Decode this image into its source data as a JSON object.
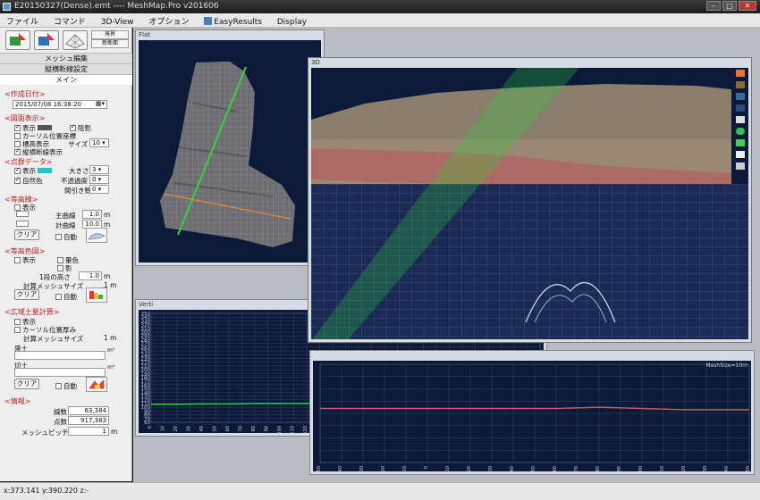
{
  "window": {
    "title": "E20150327(Dense).emt ---- MeshMap.Pro v201606"
  },
  "menu": [
    {
      "label": "ファイル"
    },
    {
      "label": "コマンド"
    },
    {
      "label": "3D-View"
    },
    {
      "label": "オプション"
    },
    {
      "label": "EasyResults"
    },
    {
      "label": "Display"
    }
  ],
  "left": {
    "small_buttons": [
      "境界",
      "新断面"
    ],
    "tabs": [
      "メッシュ編集",
      "縦横断線設定",
      "メイン"
    ],
    "date": {
      "section": "<作成日付>",
      "value": "2015/07/08 16:38:20"
    },
    "display": {
      "section": "<図面表示>",
      "show": "表示",
      "shade": "陰影",
      "cursor_coord": "カーソル位置座標",
      "elevation": "標高表示",
      "size_label": "サイズ",
      "size_value": "10",
      "profile_lines": "縦横断線表示"
    },
    "points": {
      "section": "<点群データ>",
      "show": "表示",
      "natural": "自然色",
      "size_label": "大きさ",
      "size_value": "3",
      "opacity_label": "不透過度",
      "opacity_value": "0",
      "thin_label": "間引き数",
      "thin_value": "0"
    },
    "contour": {
      "section": "<等高線>",
      "show": "表示",
      "main_label": "主曲線",
      "main_value": "1.0",
      "sub_label": "計曲線",
      "sub_value": "10.0",
      "unit": "m",
      "clear": "クリア",
      "auto": "自動"
    },
    "color": {
      "section": "<等高色図>",
      "show": "表示",
      "hatch": "暈色",
      "shadow": "影",
      "step_label": "1段の高さ",
      "step_value": "1.0",
      "unit": "m",
      "mesh_label": "計算メッシュサイズ",
      "mesh_unit": "1 m",
      "clear": "クリア",
      "auto": "自動"
    },
    "volume": {
      "section": "<広域土量計算>",
      "show": "表示",
      "cursor_thick": "カーソル位置厚み",
      "mesh_label": "計算メッシュサイズ",
      "mesh_unit": "1 m",
      "fill_label": "盛土",
      "cut_label": "切土",
      "unit": "m³",
      "clear": "クリア",
      "auto": "自動"
    },
    "info": {
      "section": "<情報>",
      "lines_label": "線数",
      "lines_value": "63,384",
      "points_label": "点数",
      "points_value": "917,383",
      "pitch_label": "メッシュピッチ",
      "pitch_value": "1",
      "unit": "m"
    }
  },
  "panes": {
    "flat": {
      "title": "Flat"
    },
    "view3d": {
      "title": "3D"
    },
    "verti": {
      "title": "Verti"
    },
    "hori": {
      "title": "MeshSize=10m"
    }
  },
  "chart_data": [
    {
      "type": "line",
      "title": "Verti",
      "y_ticks": [
        350,
        340,
        330,
        320,
        310,
        300,
        290,
        280,
        270,
        260,
        250,
        240,
        230,
        220,
        210,
        200,
        190,
        180,
        170,
        160,
        150,
        140,
        130,
        120,
        110,
        100,
        90,
        80,
        70,
        60
      ],
      "x_ticks": [
        0,
        10,
        20,
        30,
        40,
        50,
        60,
        70,
        80,
        90,
        100,
        110,
        120,
        130,
        140,
        150,
        160,
        170,
        180,
        190,
        200,
        210,
        220,
        230,
        240,
        250,
        260,
        270,
        280,
        290,
        300
      ],
      "ylim": [
        60,
        350
      ],
      "series": [
        {
          "color": "#35c435",
          "x": [
            0,
            20,
            40,
            60,
            80,
            100,
            120,
            130,
            140,
            160,
            180,
            200,
            210,
            230,
            250,
            270,
            290,
            300
          ],
          "y": [
            108,
            108,
            109,
            109,
            110,
            110,
            110,
            108,
            102,
            100,
            101,
            103,
            108,
            109,
            109,
            108,
            108,
            107
          ]
        }
      ]
    },
    {
      "type": "line",
      "title": "MeshSize=10m",
      "x_ticks": [
        -50,
        -40,
        -30,
        -20,
        -10,
        0,
        10,
        20,
        30,
        40,
        50,
        60,
        70,
        80,
        90,
        100,
        110,
        120,
        130,
        140,
        150
      ],
      "series": [
        {
          "color": "#c85a5a",
          "x": [
            -50,
            20,
            60,
            80,
            100,
            120,
            150
          ],
          "y": [
            104,
            104,
            104,
            105,
            104,
            103,
            103
          ]
        }
      ]
    }
  ],
  "status": {
    "coords": "x:373.141 y:390.220 z:-"
  },
  "colors": {
    "accent_green": "#35c435",
    "swatch_gray": "#555555",
    "swatch_cyan": "#19c8c8",
    "section_red": "#b22222"
  }
}
